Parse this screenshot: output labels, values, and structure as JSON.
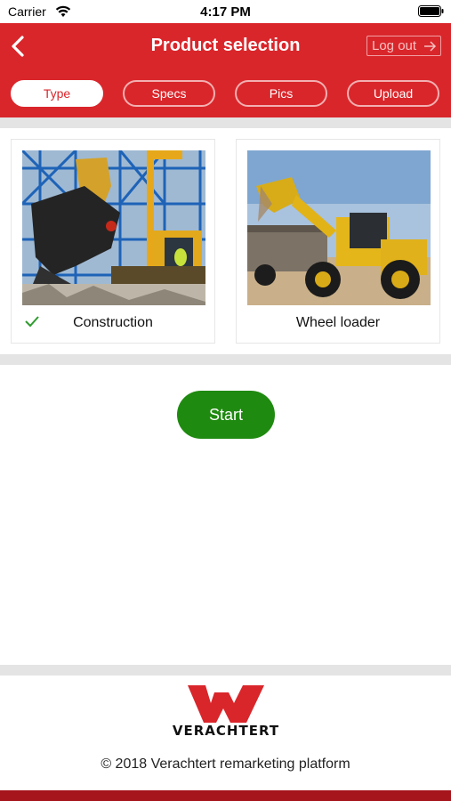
{
  "status_bar": {
    "carrier": "Carrier",
    "time": "4:17 PM"
  },
  "header": {
    "title": "Product selection",
    "logout_label": "Log out",
    "tabs": [
      {
        "label": "Type",
        "active": true
      },
      {
        "label": "Specs",
        "active": false
      },
      {
        "label": "Pics",
        "active": false
      },
      {
        "label": "Upload",
        "active": false
      }
    ]
  },
  "categories": [
    {
      "label": "Construction",
      "selected": true,
      "image": "excavator-with-demolition-shear"
    },
    {
      "label": "Wheel loader",
      "selected": false,
      "image": "wheel-loader-dumping-into-truck"
    }
  ],
  "start_label": "Start",
  "footer": {
    "logo_text": "VERACHTERT",
    "copyright": "© 2018 Verachtert remarketing platform"
  },
  "colors": {
    "brand_red": "#d9262b",
    "start_green": "#1f8a10",
    "check_green": "#2e9b2e",
    "bottom_bar": "#a6141c"
  }
}
